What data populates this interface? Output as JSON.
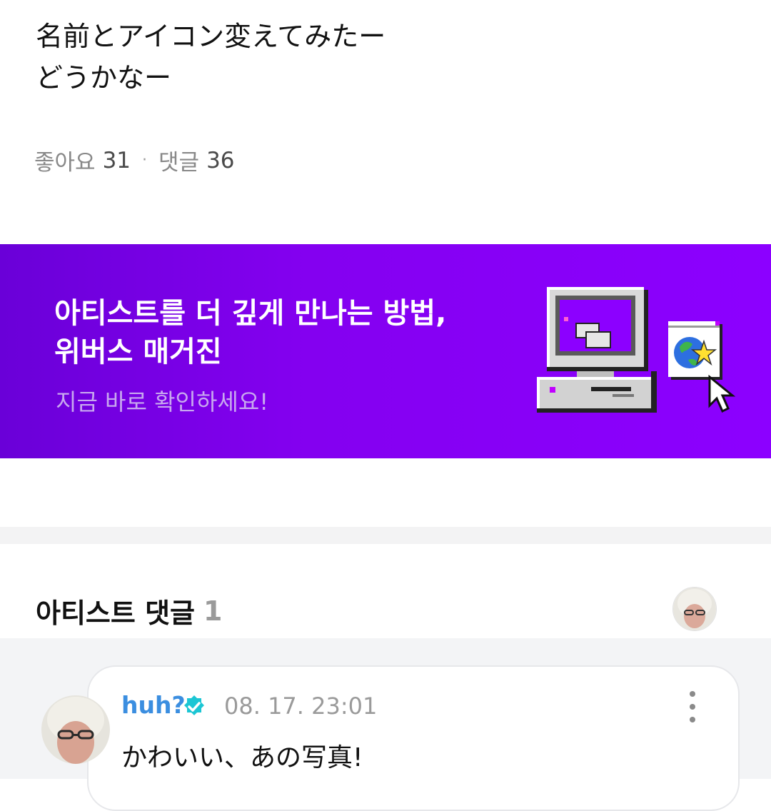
{
  "post": {
    "line1": "名前とアイコン変えてみたー",
    "line2": "どうかなー"
  },
  "stats": {
    "likes_label": "좋아요",
    "likes_count": "31",
    "separator": "·",
    "comments_label": "댓글",
    "comments_count": "36"
  },
  "banner": {
    "title_line1": "아티스트를 더 깊게 만나는 방법,",
    "title_line2": "위버스 매거진",
    "subtitle": "지금 바로 확인하세요!"
  },
  "artist_comments": {
    "title": "아티스트 댓글",
    "count": "1"
  },
  "comment": {
    "author": "huh?",
    "timestamp": "08. 17. 23:01",
    "text": "かわいい、あの写真!"
  },
  "colors": {
    "banner_purple": "#8c00ff",
    "author_blue": "#3b8ee0",
    "verified_teal": "#1cc6d4"
  },
  "icons": {
    "verified": "verified-badge-icon",
    "more": "more-vertical-icon",
    "computer": "retro-computer-illustration",
    "globe": "globe-star-icon",
    "cursor": "mouse-cursor-icon"
  }
}
